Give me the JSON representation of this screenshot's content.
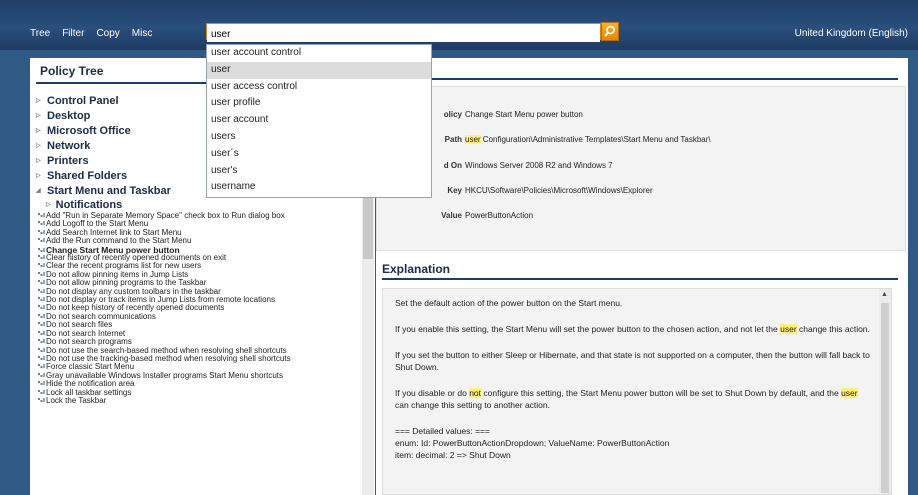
{
  "menu": [
    "Tree",
    "Filter",
    "Copy",
    "Misc"
  ],
  "search": {
    "value": "user"
  },
  "language": "United Kingdom (English)",
  "dropdown": [
    "user account control",
    "user",
    "user access control",
    "user profile",
    "user account",
    "users",
    "user´s",
    "user's",
    "username"
  ],
  "dropdown_selected_index": 1,
  "left_panel": {
    "title": "Policy Tree",
    "top_nodes": [
      "Control Panel",
      "Desktop",
      "Microsoft Office",
      "Network",
      "Printers",
      "Shared Folders",
      "Start Menu and Taskbar"
    ],
    "notifications_label": "Notifications",
    "policies": [
      "Add \"Run in Separate Memory Space\" check box to Run dialog box",
      "Add Logoff to the Start Menu",
      "Add Search Internet link to Start Menu",
      "Add the Run command to the Start Menu",
      "Change Start Menu power button",
      "Clear history of recently opened documents on exit",
      "Clear the recent programs list for new users",
      "Do not allow pinning items in Jump Lists",
      "Do not allow pinning programs to the Taskbar",
      "Do not display any custom toolbars in the taskbar",
      "Do not display or track items in Jump Lists from remote locations",
      "Do not keep history of recently opened documents",
      "Do not search communications",
      "Do not search files",
      "Do not search Internet",
      "Do not search programs",
      "Do not use the search-based method when resolving shell shortcuts",
      "Do not use the tracking-based method when resolving shell shortcuts",
      "Force classic Start Menu",
      "Gray unavailable Windows Installer programs Start Menu shortcuts",
      "Hide the notification area",
      "Lock all taskbar settings",
      "Lock the Taskbar"
    ],
    "bold_policy_index": 4
  },
  "details": {
    "policy_label": "olicy",
    "policy_value": "Change Start Menu power button",
    "path_label": "Path",
    "path_highlight": "user",
    "path_value": " Configuration\\Administrative Templates\\Start Menu and Taskbar\\",
    "supported_label": "d On",
    "supported_value": "Windows Server 2008 R2 and Windows 7",
    "key_label": "Key",
    "key_value": "HKCU\\Software\\Policies\\Microsoft\\Windows\\Explorer",
    "value_label": "Value",
    "value_value": "PowerButtonAction"
  },
  "explanation": {
    "title": "Explanation",
    "p1": "Set the default action of the power button on the Start menu.",
    "p2_a": "If you enable this setting, the Start Menu will set the power button to the chosen action, and not let the ",
    "p2_hl": "user",
    "p2_b": " change this action.",
    "p3": "If you set the button to either Sleep or Hibernate, and that state is not supported on a computer, then the button will fall back to Shut Down.",
    "p4_a": "If you disable or do ",
    "p4_hl1": "not",
    "p4_b": " configure this setting, the Start Menu power button will be set to Shut Down by default, and the ",
    "p4_hl2": "user",
    "p4_c": " can change this setting to another action.",
    "l1": "=== Detailed values: ===",
    "l2": "enum: Id: PowerButtonActionDropdown; ValueName: PowerButtonAction",
    "l3": "item: decimal: 2 => Shut Down"
  },
  "colors": {
    "accent": "#e0860d",
    "highlight": "#fff176",
    "header_blue": "#1a3d6b"
  }
}
